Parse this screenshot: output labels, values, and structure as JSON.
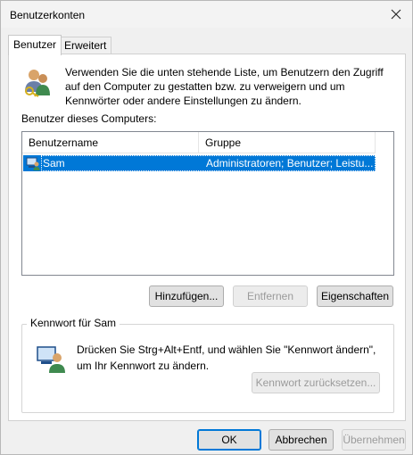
{
  "window": {
    "title": "Benutzerkonten"
  },
  "tabs": [
    {
      "label": "Benutzer",
      "active": true
    },
    {
      "label": "Erweitert",
      "active": false
    }
  ],
  "intro": {
    "text": "Verwenden Sie die unten stehende Liste, um Benutzern den Zugriff auf den Computer zu gestatten bzw. zu verweigern und um Kennwörter oder andere Einstellungen zu ändern."
  },
  "users": {
    "label": "Benutzer dieses Computers:",
    "columns": [
      "Benutzername",
      "Gruppe"
    ],
    "rows": [
      {
        "name": "Sam",
        "group": "Administratoren; Benutzer; Leistu...",
        "selected": true
      }
    ]
  },
  "user_buttons": {
    "add": "Hinzufügen...",
    "remove": "Entfernen",
    "properties": "Eigenschaften"
  },
  "password": {
    "group_title": "Kennwort für Sam",
    "text": "Drücken Sie Strg+Alt+Entf, und wählen Sie \"Kennwort ändern\", um Ihr Kennwort zu ändern.",
    "reset_button": "Kennwort zurücksetzen..."
  },
  "footer": {
    "ok": "OK",
    "cancel": "Abbrechen",
    "apply": "Übernehmen"
  },
  "colors": {
    "selection": "#0078d7",
    "default_button_border": "#0078d7"
  },
  "icons": [
    "close-icon",
    "users-keys-icon",
    "user-row-icon",
    "user-password-icon"
  ]
}
